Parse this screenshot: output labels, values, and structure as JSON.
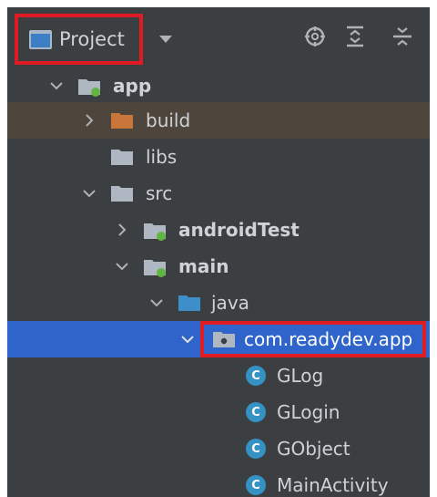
{
  "toolbar": {
    "view_label": "Project",
    "icons": [
      "view-mode-icon",
      "dropdown-caret-icon",
      "locate-target-icon",
      "expand-all-icon",
      "collapse-all-icon"
    ]
  },
  "tree": [
    {
      "label": "app",
      "icon": "module-folder-icon",
      "expanded": true
    },
    {
      "label": "build",
      "icon": "orange-folder-icon",
      "expanded": false
    },
    {
      "label": "libs",
      "icon": "folder-icon"
    },
    {
      "label": "src",
      "icon": "folder-icon",
      "expanded": true
    },
    {
      "label": "androidTest",
      "icon": "module-folder-icon",
      "expanded": false
    },
    {
      "label": "main",
      "icon": "module-folder-icon",
      "expanded": true
    },
    {
      "label": "java",
      "icon": "blue-source-folder-icon",
      "expanded": true
    },
    {
      "label": "com.readydev.app",
      "icon": "package-icon",
      "expanded": true,
      "selected": true
    },
    {
      "label": "GLog",
      "icon": "class-icon",
      "badge": "C"
    },
    {
      "label": "GLogin",
      "icon": "class-icon",
      "badge": "C"
    },
    {
      "label": "GObject",
      "icon": "class-icon",
      "badge": "C"
    },
    {
      "label": "MainActivity",
      "icon": "class-icon",
      "badge": "C"
    }
  ],
  "colors": {
    "background": "#3c3f41",
    "selection": "#2f65ca",
    "highlight_build": "#4e463d",
    "annotation": "#e01b24",
    "class_badge": "#3592c4",
    "folder_gray": "#aeb7c2",
    "folder_orange": "#c9763b",
    "folder_blue": "#3e8fc9",
    "module_dot": "#62b543"
  }
}
